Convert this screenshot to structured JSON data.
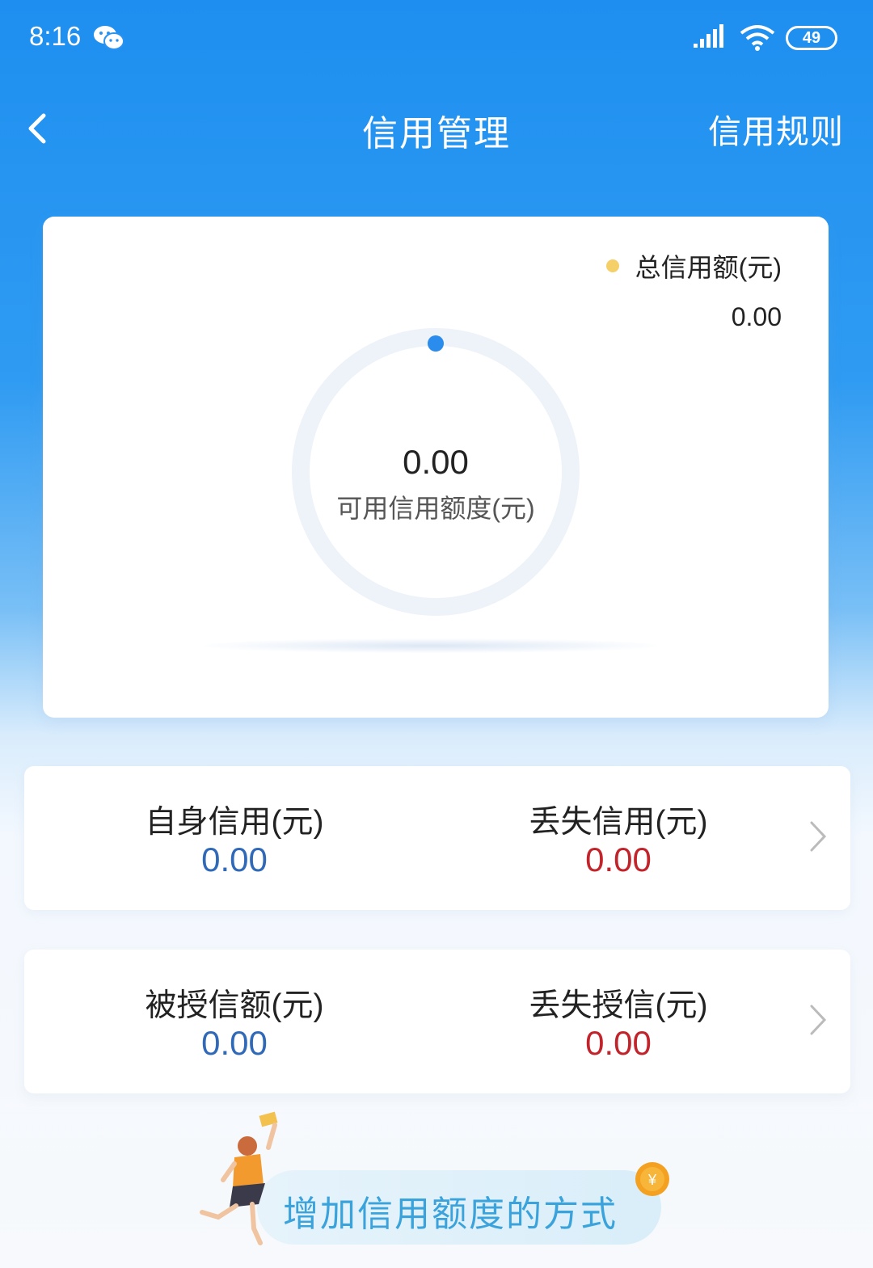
{
  "status_bar": {
    "time": "8:16",
    "battery": "49"
  },
  "header": {
    "title": "信用管理",
    "rules_link": "信用规则"
  },
  "summary": {
    "legend_label": "总信用额(元)",
    "total_value": "0.00",
    "available_value": "0.00",
    "available_label": "可用信用额度(元)"
  },
  "credit_rows": [
    {
      "left": {
        "label": "自身信用(元)",
        "value": "0.00"
      },
      "right": {
        "label": "丢失信用(元)",
        "value": "0.00"
      }
    },
    {
      "left": {
        "label": "被授信额(元)",
        "value": "0.00"
      },
      "right": {
        "label": "丢失授信(元)",
        "value": "0.00"
      }
    }
  ],
  "promo": {
    "text": "增加信用额度的方式"
  },
  "colors": {
    "header_blue": "#1e8ff0",
    "positive_value": "#2f69b8",
    "negative_value": "#c2242c",
    "legend_dot": "#f5cf67",
    "promo_text": "#3aa3dc"
  },
  "icons": [
    "wechat-icon",
    "signal-icon",
    "wifi-icon",
    "back-arrow-icon",
    "chevron-right-icon",
    "coin-icon"
  ]
}
